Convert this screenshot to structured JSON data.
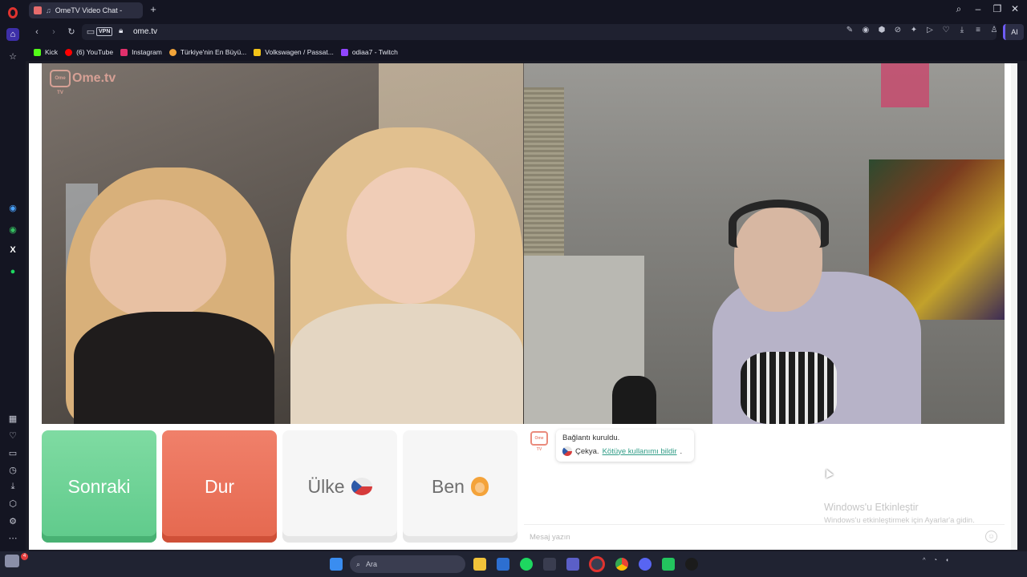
{
  "browser": {
    "tab_title": "OmeTV Video Chat -",
    "url": "ome.tv",
    "vpn_label": "VPN",
    "ai_label": "AI",
    "new_tab_symbol": "+"
  },
  "bookmarks": [
    {
      "label": "Kick",
      "color": "#53fc18"
    },
    {
      "label": "(6) YouTube",
      "color": "#ff0000"
    },
    {
      "label": "Instagram",
      "color": "#e1306c"
    },
    {
      "label": "Türkiye'nin En Büyü...",
      "color": "#f2a43a"
    },
    {
      "label": "Volkswagen / Passat...",
      "color": "#f2c318"
    },
    {
      "label": "odiaa7 - Twitch",
      "color": "#9146ff"
    }
  ],
  "ometv": {
    "logo_text": "Ome.tv",
    "logo_badge": "Ome TV"
  },
  "buttons": {
    "next": "Sonraki",
    "stop": "Dur",
    "country": "Ülke",
    "me": "Ben"
  },
  "chat": {
    "status": "Bağlantı kuruldu.",
    "country": "Çekya.",
    "report_link": "Kötüye kullanımı bildir",
    "report_suffix": ".",
    "input_placeholder": "Mesaj yazın"
  },
  "activation": {
    "title": "Windows'u Etkinleştir",
    "subtitle": "Windows'u etkinleştirmek için Ayarlar'a gidin."
  },
  "taskbar": {
    "search_placeholder": "Ara",
    "notification_count": "4"
  },
  "colors": {
    "next": "#63cc8e",
    "stop": "#e86a52",
    "link": "#2f9c86",
    "opera_red": "#e0332f"
  }
}
